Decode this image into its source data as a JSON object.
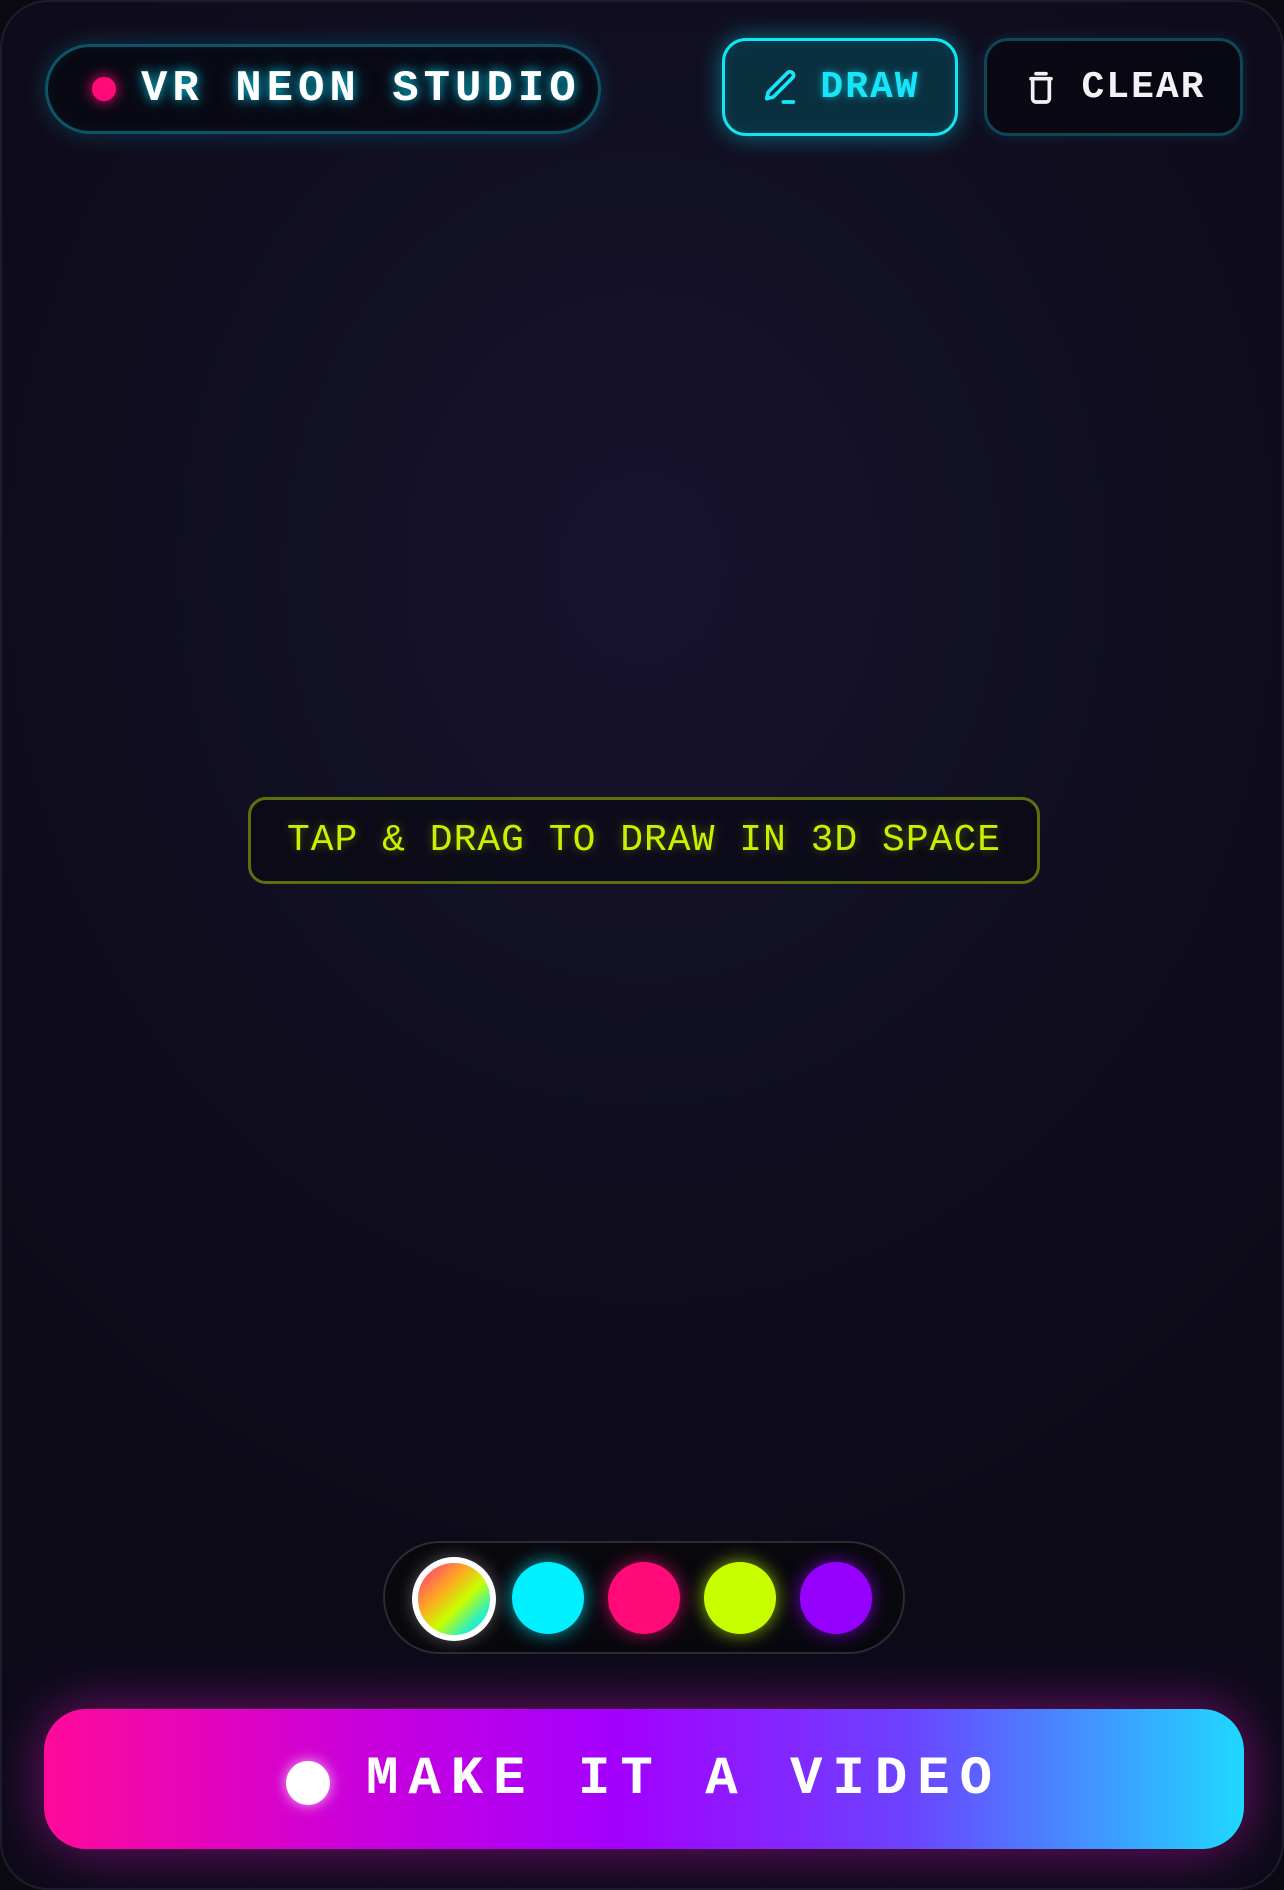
{
  "app": {
    "title": "VR NEON STUDIO"
  },
  "toolbar": {
    "draw_label": "DRAW",
    "draw_icon": "pencil-icon",
    "clear_label": "CLEAR",
    "clear_icon": "trash-icon"
  },
  "canvas": {
    "hint": "TAP & DRAG TO DRAW IN 3D SPACE"
  },
  "palette": {
    "selected": "rainbow",
    "swatches": [
      {
        "name": "rainbow",
        "color": "gradient"
      },
      {
        "name": "cyan",
        "color": "#00F0FF"
      },
      {
        "name": "pink",
        "color": "#FF0A78"
      },
      {
        "name": "lime",
        "color": "#C8FF00"
      },
      {
        "name": "purple",
        "color": "#9500FF"
      }
    ]
  },
  "cta": {
    "label": "MAKE IT A VIDEO",
    "icon": "record-dot-icon"
  },
  "colors": {
    "accent_cyan": "#17E6F8",
    "accent_pink": "#FF0A78",
    "accent_lime": "#C8F000",
    "background": "#110F22"
  }
}
